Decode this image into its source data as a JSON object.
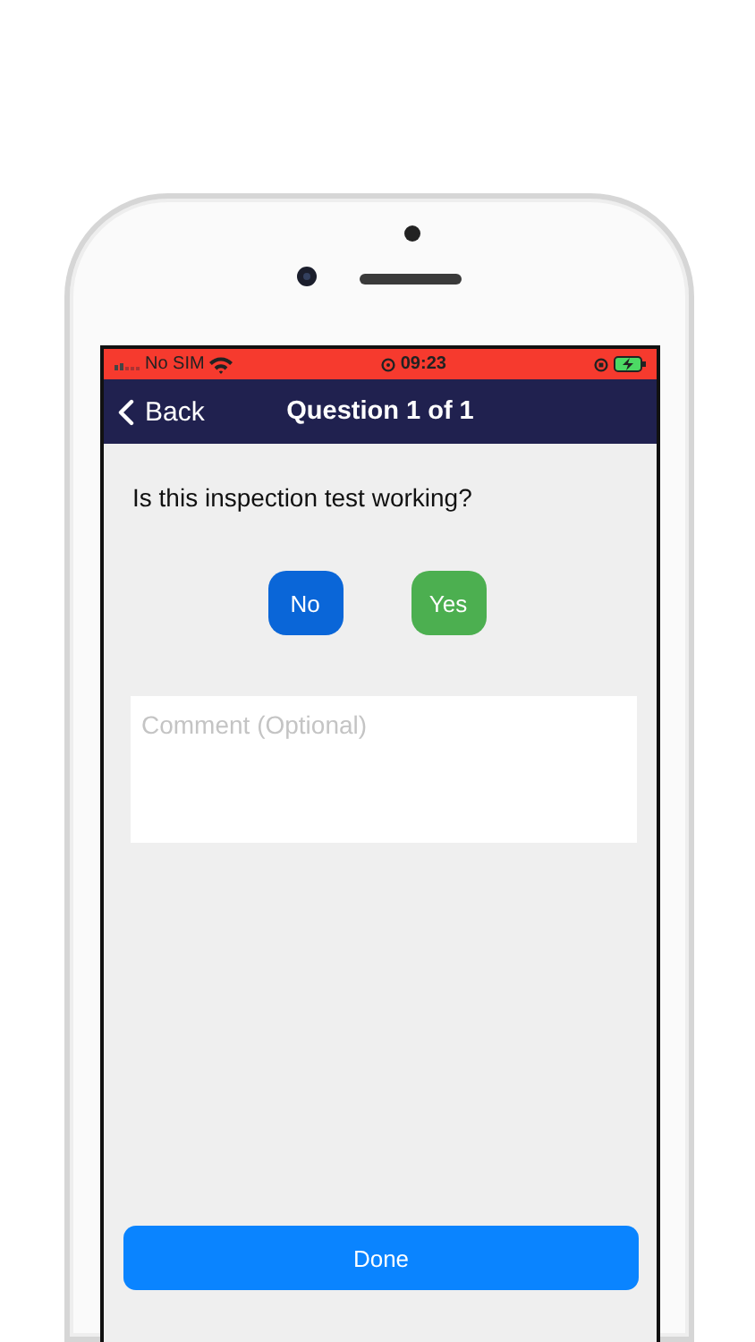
{
  "status_bar": {
    "carrier": "No SIM",
    "time": "09:23"
  },
  "nav_bar": {
    "back": "Back",
    "title": "Question 1 of 1"
  },
  "question": "Is this inspection test working?",
  "answers": [
    {
      "label": "No",
      "color": "#0a66d8"
    },
    {
      "label": "Yes",
      "color": "#4caf50"
    }
  ],
  "comment": {
    "placeholder": "Comment (Optional)"
  },
  "done_button": "Done"
}
